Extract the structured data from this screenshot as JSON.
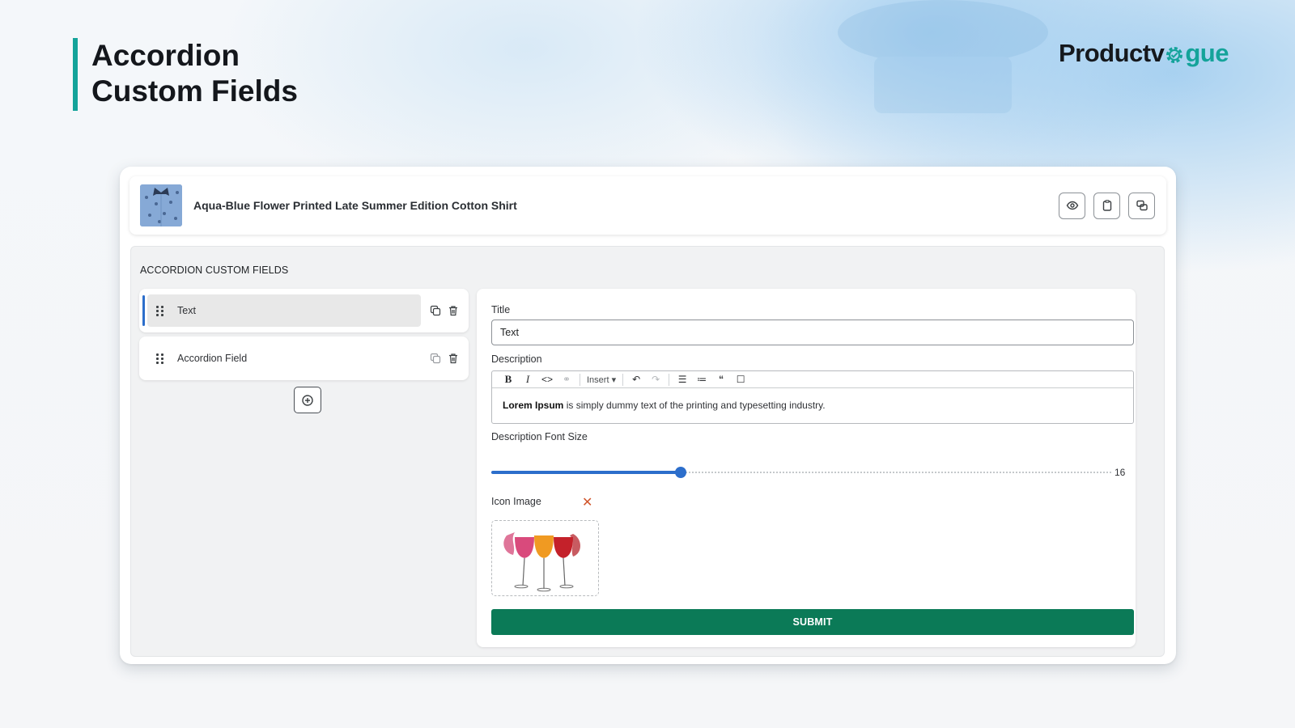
{
  "hero": {
    "line1": "Accordion",
    "line2": "Custom Fields"
  },
  "brand": {
    "part1": "Productv",
    "part2": "gue",
    "gear_icon": "gear-check-icon",
    "accent": "#14a39a"
  },
  "product": {
    "name": "Aqua-Blue Flower Printed Late Summer Edition Cotton Shirt",
    "actions": [
      "eye-icon",
      "clipboard-icon",
      "duplicate-icon"
    ]
  },
  "section_title": "ACCORDION CUSTOM FIELDS",
  "fields": [
    {
      "label": "Text",
      "active": true
    },
    {
      "label": "Accordion Field",
      "active": false
    }
  ],
  "editor": {
    "title_label": "Title",
    "title_value": "Text",
    "description_label": "Description",
    "toolbar": {
      "insert_label": "Insert"
    },
    "description_bold": "Lorem Ipsum",
    "description_rest": " is simply dummy text of the printing and typesetting industry.",
    "font_size_label": "Description Font Size",
    "font_size_value": "16",
    "font_size_fraction": 0.305,
    "icon_image_label": "Icon Image",
    "remove_symbol": "✕",
    "submit_label": "SUBMIT"
  },
  "colors": {
    "primary": "#2c6ecb",
    "submit": "#0b7a57",
    "remove": "#d0552b"
  }
}
